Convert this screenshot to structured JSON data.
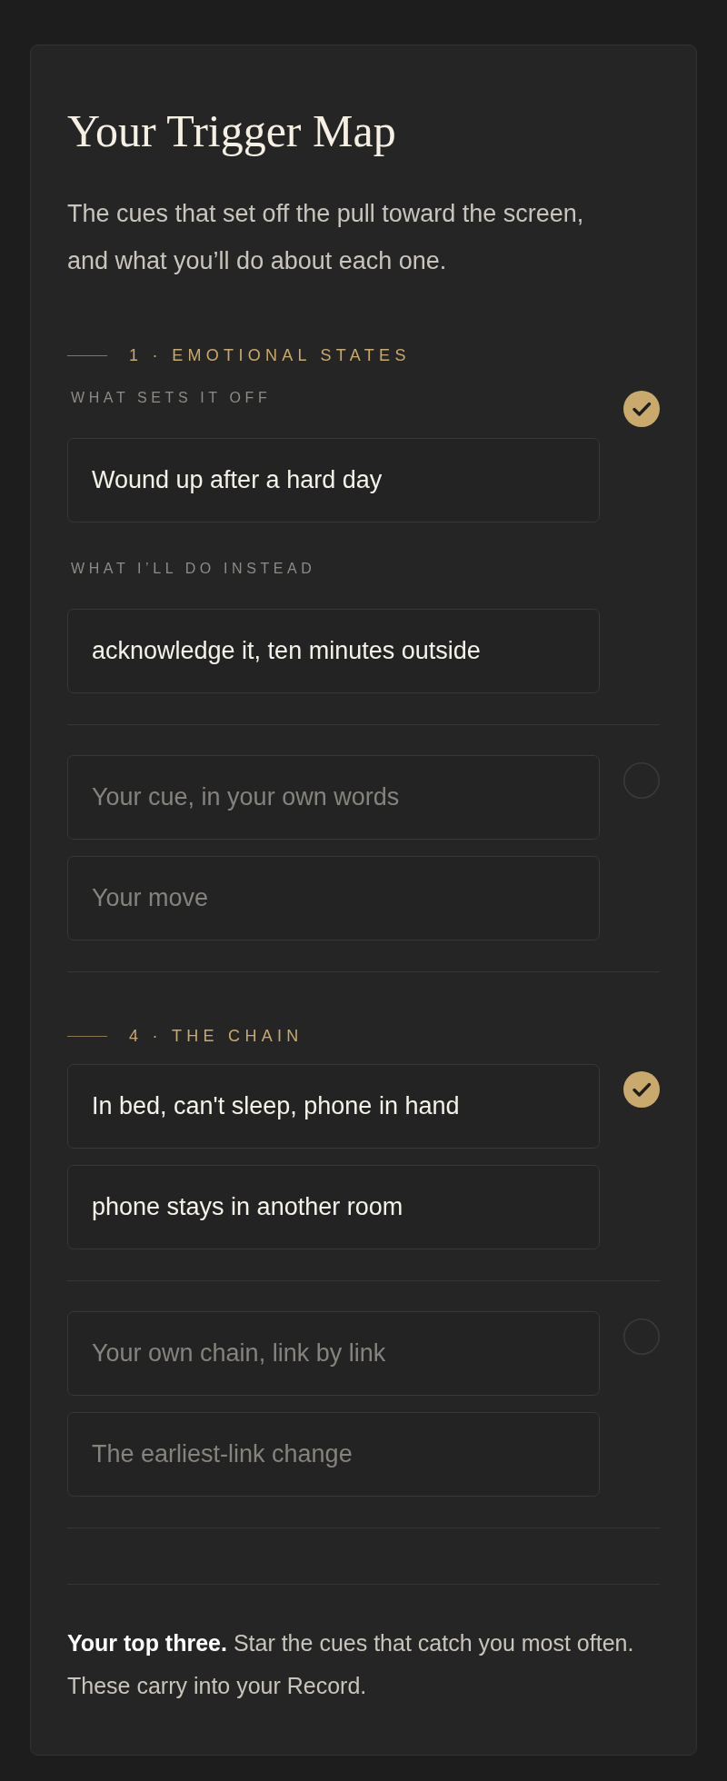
{
  "title": "Your Trigger Map",
  "intro": "The cues that set off the pull toward the screen, and what you’ll do about each one.",
  "sections": [
    {
      "heading": "1 · EMOTIONAL STATES",
      "entries": [
        {
          "kind": "labeled",
          "cue_label": "WHAT SETS IT OFF",
          "cue": {
            "value": "Wound up after a hard day"
          },
          "move_label": "WHAT I’LL DO INSTEAD",
          "move": {
            "value": "acknowledge it, ten minutes outside"
          },
          "checked": true
        },
        {
          "kind": "plain",
          "cue": {
            "placeholder": "Your cue, in your own words"
          },
          "move": {
            "placeholder": "Your move"
          },
          "checked": false
        }
      ]
    },
    {
      "heading": "4 · THE CHAIN",
      "entries": [
        {
          "kind": "plain",
          "cue": {
            "value": "In bed, can't sleep, phone in hand"
          },
          "move": {
            "value": "phone stays in another room"
          },
          "checked": true
        },
        {
          "kind": "plain",
          "cue": {
            "placeholder": "Your own chain, link by link"
          },
          "move": {
            "placeholder": "The earliest-link change"
          },
          "checked": false
        }
      ]
    }
  ],
  "footer": "**Your top three.** Star the cues that catch you most often. These carry into your Record."
}
